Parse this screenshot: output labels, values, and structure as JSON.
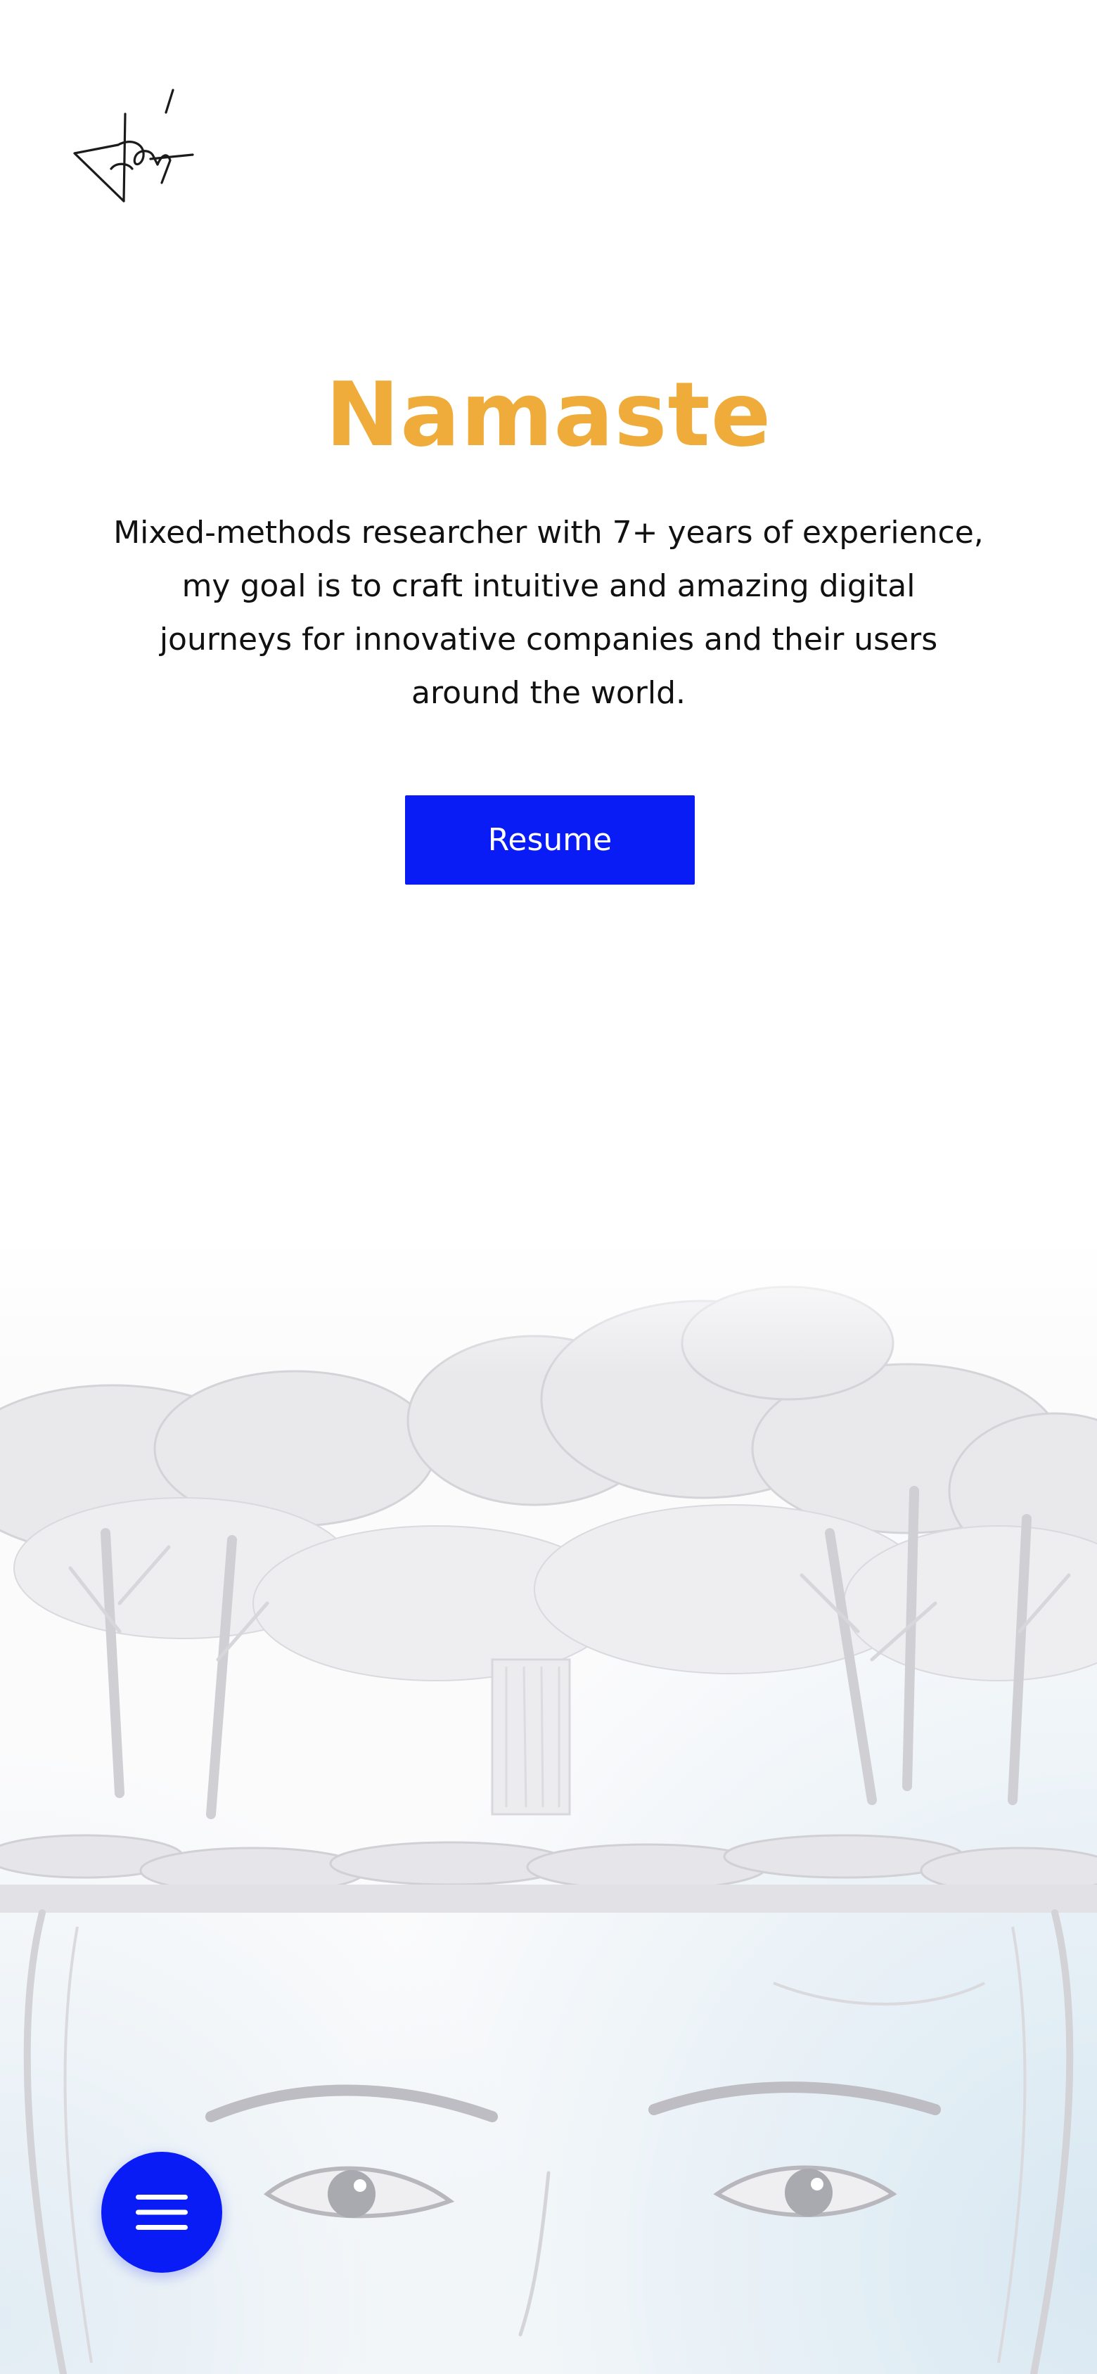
{
  "header": {
    "logo_icon": "signature-logo-icon"
  },
  "hero": {
    "title": "Namaste",
    "description": "Mixed-methods researcher with 7+ years of experience, my goal is to craft intuitive and amazing digital journeys for innovative companies and their users around the world.",
    "resume_label": "Resume"
  },
  "background": {
    "illustration": "pencil-sketch-forest-and-face"
  },
  "menu": {
    "icon": "hamburger-menu-icon"
  },
  "colors": {
    "title": "#efac3a",
    "accent": "#0a1cf5",
    "text": "#111111",
    "background": "#ffffff"
  }
}
